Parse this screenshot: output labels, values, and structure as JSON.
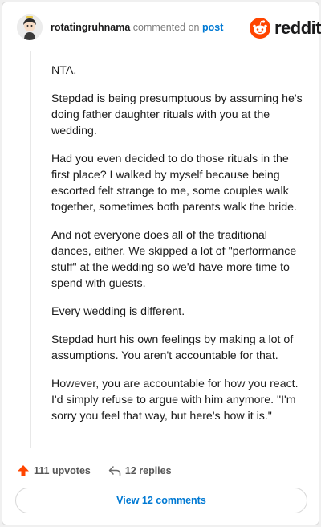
{
  "header": {
    "username": "rotatingruhnama",
    "commented_on": "commented on",
    "post_link": "post",
    "brand": "reddit",
    "colors": {
      "brand_orange": "#ff4500",
      "link_blue": "#0079d3"
    }
  },
  "comment": {
    "paragraphs": [
      "NTA.",
      "Stepdad is being presumptuous by assuming he's doing father daughter rituals with you at the wedding.",
      "Had you even decided to do those rituals in the first place? I walked by myself because being escorted felt strange to me, some couples walk together, sometimes both parents walk the bride.",
      "And not everyone does all of the traditional dances, either. We skipped a lot of \"performance stuff\" at the wedding so we'd have more time to spend with guests.",
      "Every wedding is different.",
      "Stepdad hurt his own feelings by making a lot of assumptions. You aren't accountable for that.",
      "However, you are accountable for how you react. I'd simply refuse to argue with him anymore. \"I'm sorry you feel that way, but here's how it is.\""
    ]
  },
  "actions": {
    "upvotes": "111 upvotes",
    "replies": "12 replies",
    "view_comments": "View 12 comments"
  },
  "icons": {
    "upvote": "upvote-arrow-icon",
    "reply": "reply-arrow-icon",
    "avatar": "avatar",
    "logo": "reddit-snoo-icon"
  }
}
